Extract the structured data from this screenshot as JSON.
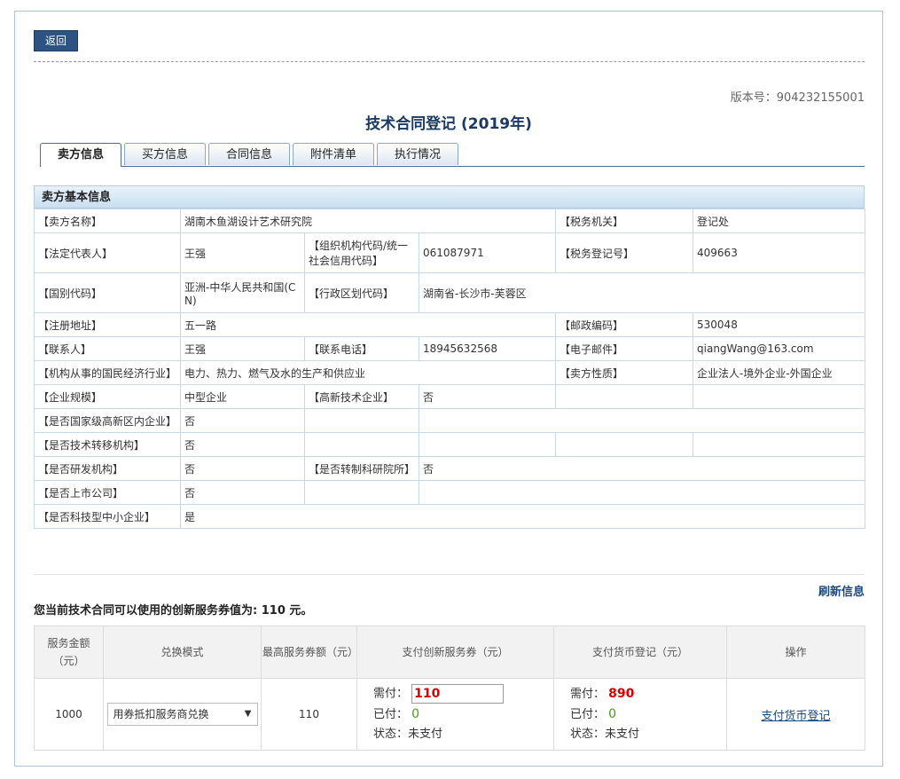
{
  "toolbar": {
    "back_label": "返回"
  },
  "version": {
    "label": "版本号：",
    "value": "904232155001"
  },
  "page_title": "技术合同登记 (2019年)",
  "tabs": [
    {
      "label": "卖方信息"
    },
    {
      "label": "买方信息"
    },
    {
      "label": "合同信息"
    },
    {
      "label": "附件清单"
    },
    {
      "label": "执行情况"
    }
  ],
  "section_title": "卖方基本信息",
  "seller": {
    "name_label": "【卖方名称】",
    "name": "湖南木鱼湖设计艺术研究院",
    "tax_authority_label": "【税务机关】",
    "tax_authority": "登记处",
    "legal_rep_label": "【法定代表人】",
    "legal_rep": "王强",
    "org_code_label": "【组织机构代码/统一社会信用代码】",
    "org_code": "061087971",
    "tax_reg_label": "【税务登记号】",
    "tax_reg": "409663",
    "country_label": "【国别代码】",
    "country": "亚洲-中华人民共和国(CN)",
    "region_label": "【行政区划代码】",
    "region": "湖南省-长沙市-芙蓉区",
    "address_label": "【注册地址】",
    "address": "五一路",
    "postcode_label": "【邮政编码】",
    "postcode": "530048",
    "contact_label": "【联系人】",
    "contact": "王强",
    "phone_label": "【联系电话】",
    "phone": "18945632568",
    "email_label": "【电子邮件】",
    "email": "qiangWang@163.com",
    "industry_label": "【机构从事的国民经济行业】",
    "industry": "电力、热力、燃气及水的生产和供应业",
    "nature_label": "【卖方性质】",
    "nature": "企业法人-境外企业-外国企业",
    "scale_label": "【企业规模】",
    "scale": "中型企业",
    "hightech_label": "【高新技术企业】",
    "hightech": "否",
    "hightech_zone_label": "【是否国家级高新区内企业】",
    "hightech_zone": "否",
    "transfer_org_label": "【是否技术转移机构】",
    "transfer_org": "否",
    "rd_org_label": "【是否研发机构】",
    "rd_org": "否",
    "converted_inst_label": "【是否转制科研院所】",
    "converted_inst": "否",
    "listed_label": "【是否上市公司】",
    "listed": "否",
    "sme_label": "【是否科技型中小企业】",
    "sme": "是"
  },
  "refresh_label": "刷新信息",
  "voucher_text": "您当前技术合同可以使用的创新服务券值为: 110 元。",
  "pay_table": {
    "headers": [
      "服务金额（元）",
      "兑换模式",
      "最高服务券额（元）",
      "支付创新服务券（元）",
      "支付货币登记（元）",
      "操作"
    ],
    "row": {
      "amount": "1000",
      "mode": "用券抵扣服务商兑换",
      "max_voucher": "110",
      "voucher_due_label": "需付：",
      "voucher_due": "110",
      "voucher_paid_label": "已付：",
      "voucher_paid": "0",
      "voucher_status": "状态：未支付",
      "cash_due_label": "需付：",
      "cash_due": "890",
      "cash_paid_label": "已付：",
      "cash_paid": "0",
      "cash_status": "状态：未支付",
      "action": "支付货币登记"
    }
  }
}
